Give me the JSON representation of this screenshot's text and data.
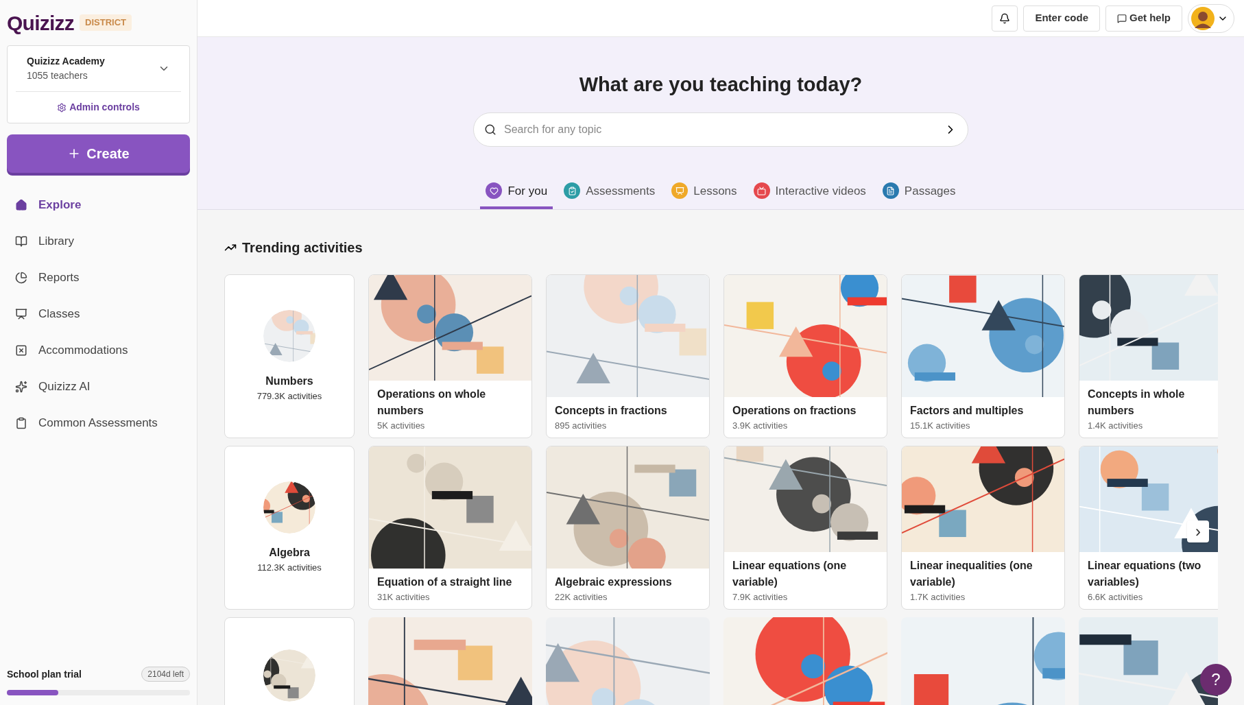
{
  "brand": {
    "logo": "Quizizz",
    "badge": "DISTRICT"
  },
  "org": {
    "name": "Quizizz Academy",
    "count": "1055 teachers",
    "admin": "Admin controls"
  },
  "create": "Create",
  "nav": [
    {
      "label": "Explore",
      "selected": true
    },
    {
      "label": "Library",
      "selected": false
    },
    {
      "label": "Reports",
      "selected": false
    },
    {
      "label": "Classes",
      "selected": false
    },
    {
      "label": "Accommodations",
      "selected": false
    },
    {
      "label": "Quizizz AI",
      "selected": false
    },
    {
      "label": "Common Assessments",
      "selected": false
    }
  ],
  "trial": {
    "label": "School plan trial",
    "remaining": "2104d left",
    "level": 0.28
  },
  "topbar": {
    "enter_code": "Enter code",
    "help": "Get help"
  },
  "hero": {
    "title": "What are you teaching today?",
    "placeholder": "Search for any topic"
  },
  "tabs": [
    {
      "label": "For you",
      "selected": true,
      "color": "#8854c0"
    },
    {
      "label": "Assessments",
      "selected": false,
      "color": "#2d9da6"
    },
    {
      "label": "Lessons",
      "selected": false,
      "color": "#efa929"
    },
    {
      "label": "Interactive videos",
      "selected": false,
      "color": "#e5484d"
    },
    {
      "label": "Passages",
      "selected": false,
      "color": "#2a7aaf"
    }
  ],
  "section": {
    "title": "Trending activities"
  },
  "rows": [
    {
      "category": {
        "title": "Numbers",
        "count": "779.3K activities"
      },
      "activities": [
        {
          "title": "Operations on whole numbers",
          "count": "5K activities"
        },
        {
          "title": "Concepts in fractions",
          "count": "895 activities"
        },
        {
          "title": "Operations on fractions",
          "count": "3.9K activities"
        },
        {
          "title": "Factors and multiples",
          "count": "15.1K activities"
        },
        {
          "title": "Concepts in whole numbers",
          "count": "1.4K activities"
        }
      ]
    },
    {
      "category": {
        "title": "Algebra",
        "count": "112.3K activities"
      },
      "activities": [
        {
          "title": "Equation of a straight line",
          "count": "31K activities"
        },
        {
          "title": "Algebraic expressions",
          "count": "22K activities"
        },
        {
          "title": "Linear equations (one variable)",
          "count": "7.9K activities"
        },
        {
          "title": "Linear inequalities (one variable)",
          "count": "1.7K activities"
        },
        {
          "title": "Linear equations (two variables)",
          "count": "6.6K activities"
        }
      ],
      "next_arrow": "›"
    },
    {
      "category": {
        "kind": "picture"
      },
      "activities": [
        {
          "kind": "picture"
        },
        {
          "kind": "picture"
        },
        {
          "kind": "picture"
        },
        {
          "kind": "picture"
        },
        {
          "kind": "picture"
        }
      ]
    }
  ],
  "help_button": "?"
}
